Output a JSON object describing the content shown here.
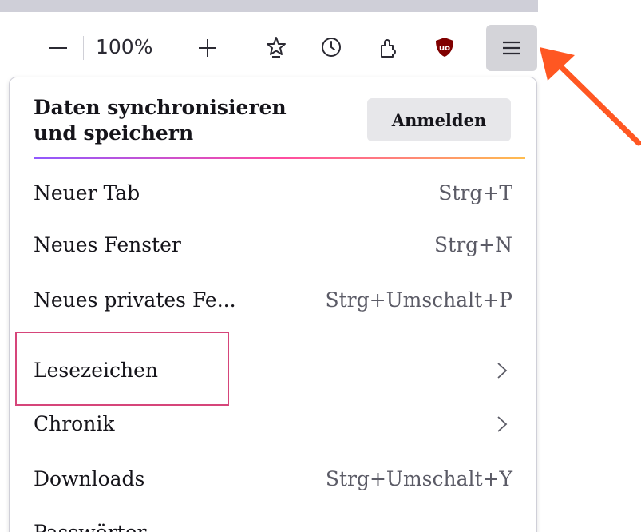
{
  "toolbar": {
    "zoom_out_label": "—",
    "zoom_level": "100%",
    "zoom_in_label": "+",
    "icons": [
      "bookmark-star-icon",
      "history-clock-icon",
      "extensions-puzzle-icon",
      "ublock-origin-icon",
      "hamburger-menu-icon"
    ]
  },
  "panel": {
    "sync_title_line1": "Daten synchronisieren",
    "sync_title_line2": "und speichern",
    "signin_label": "Anmelden",
    "items": [
      {
        "label": "Neuer Tab",
        "shortcut": "Strg+T"
      },
      {
        "label": "Neues Fenster",
        "shortcut": "Strg+N"
      },
      {
        "label": "Neues privates Fe...",
        "shortcut": "Strg+Umschalt+P"
      },
      {
        "label": "Lesezeichen",
        "submenu": true
      },
      {
        "label": "Chronik",
        "submenu": true
      },
      {
        "label": "Downloads",
        "shortcut": "Strg+Umschalt+Y"
      },
      {
        "label": "Passwörter"
      }
    ]
  },
  "colors": {
    "menu_button_bg": "#d4d4d9",
    "highlight_box": "#d6457a",
    "arrow": "#ff5722",
    "ublock_red": "#800000"
  }
}
